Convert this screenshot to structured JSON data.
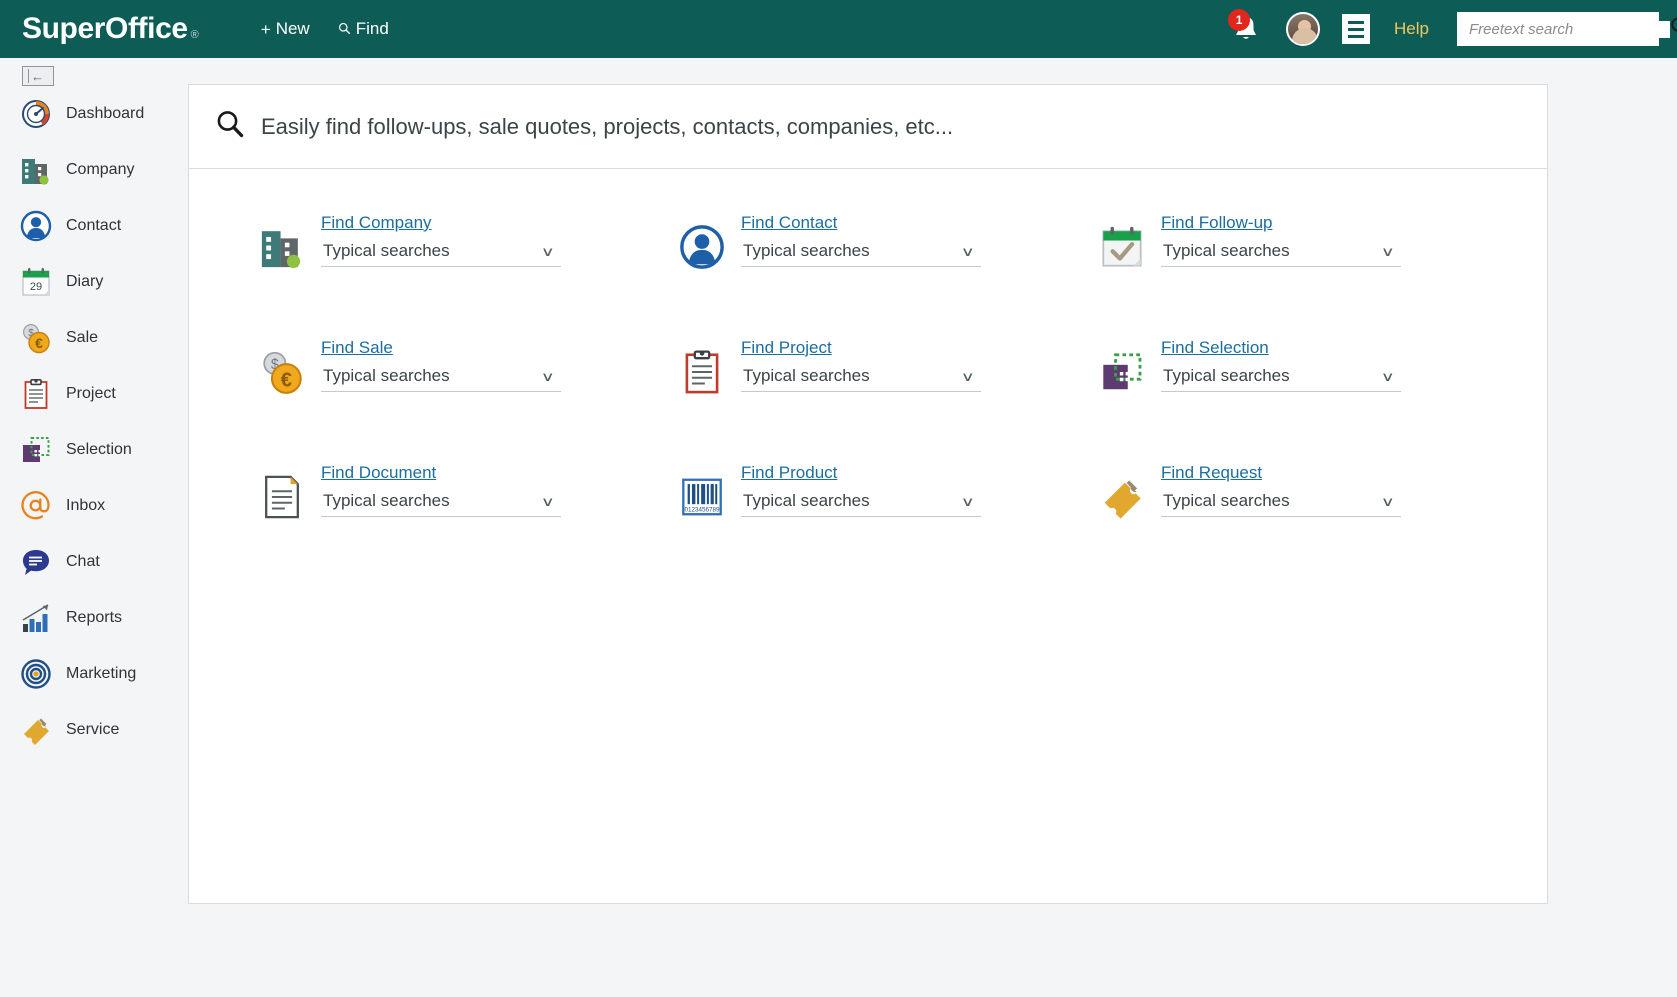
{
  "brand": {
    "name": "SuperOffice",
    "registered": "®",
    "header_bg": "#0d5c56",
    "link_color": "#1b6e9e",
    "badge_color": "#e1261c",
    "help_color": "#f2c75c"
  },
  "topnav": {
    "new_label": "New",
    "new_glyph": "+",
    "find_label": "Find",
    "find_icon": "search-icon",
    "notification_count": "1",
    "bell_icon": "bell-icon",
    "avatar_icon": "user-avatar",
    "menu_icon": "hamburger-menu-icon",
    "help_label": "Help",
    "search_placeholder": "Freetext search",
    "search_value": "",
    "search_icon": "magnifier-icon"
  },
  "sidebar": {
    "collapse_icon": "collapse-sidebar-icon",
    "items": [
      {
        "label": "Dashboard",
        "icon": "gauge-icon"
      },
      {
        "label": "Company",
        "icon": "building-icon"
      },
      {
        "label": "Contact",
        "icon": "person-circle-icon"
      },
      {
        "label": "Diary",
        "icon": "calendar-icon",
        "day": "29"
      },
      {
        "label": "Sale",
        "icon": "coins-icon"
      },
      {
        "label": "Project",
        "icon": "clipboard-icon"
      },
      {
        "label": "Selection",
        "icon": "selection-icon"
      },
      {
        "label": "Inbox",
        "icon": "at-sign-icon"
      },
      {
        "label": "Chat",
        "icon": "chat-bubble-icon"
      },
      {
        "label": "Reports",
        "icon": "bar-chart-icon"
      },
      {
        "label": "Marketing",
        "icon": "target-icon"
      },
      {
        "label": "Service",
        "icon": "ticket-icon"
      }
    ]
  },
  "main": {
    "hero_icon": "magnifier-icon",
    "hero_placeholder": "Easily find follow-ups, sale quotes, projects, contacts, companies, etc...",
    "dropdown_label": "Typical searches",
    "chevron_icon": "chevron-down-icon",
    "tiles": [
      {
        "link": "Find Company",
        "icon": "building-icon",
        "dropdown": "Typical searches"
      },
      {
        "link": "Find Contact",
        "icon": "person-circle-icon",
        "dropdown": "Typical searches"
      },
      {
        "link": "Find Follow-up",
        "icon": "calendar-check-icon",
        "dropdown": "Typical searches"
      },
      {
        "link": "Find Sale",
        "icon": "coins-icon",
        "dropdown": "Typical searches"
      },
      {
        "link": "Find Project",
        "icon": "clipboard-icon",
        "dropdown": "Typical searches"
      },
      {
        "link": "Find Selection",
        "icon": "selection-icon",
        "dropdown": "Typical searches"
      },
      {
        "link": "Find Document",
        "icon": "document-icon",
        "dropdown": "Typical searches"
      },
      {
        "link": "Find Product",
        "icon": "barcode-icon",
        "dropdown": "Typical searches"
      },
      {
        "link": "Find Request",
        "icon": "ticket-icon",
        "dropdown": "Typical searches"
      }
    ]
  }
}
